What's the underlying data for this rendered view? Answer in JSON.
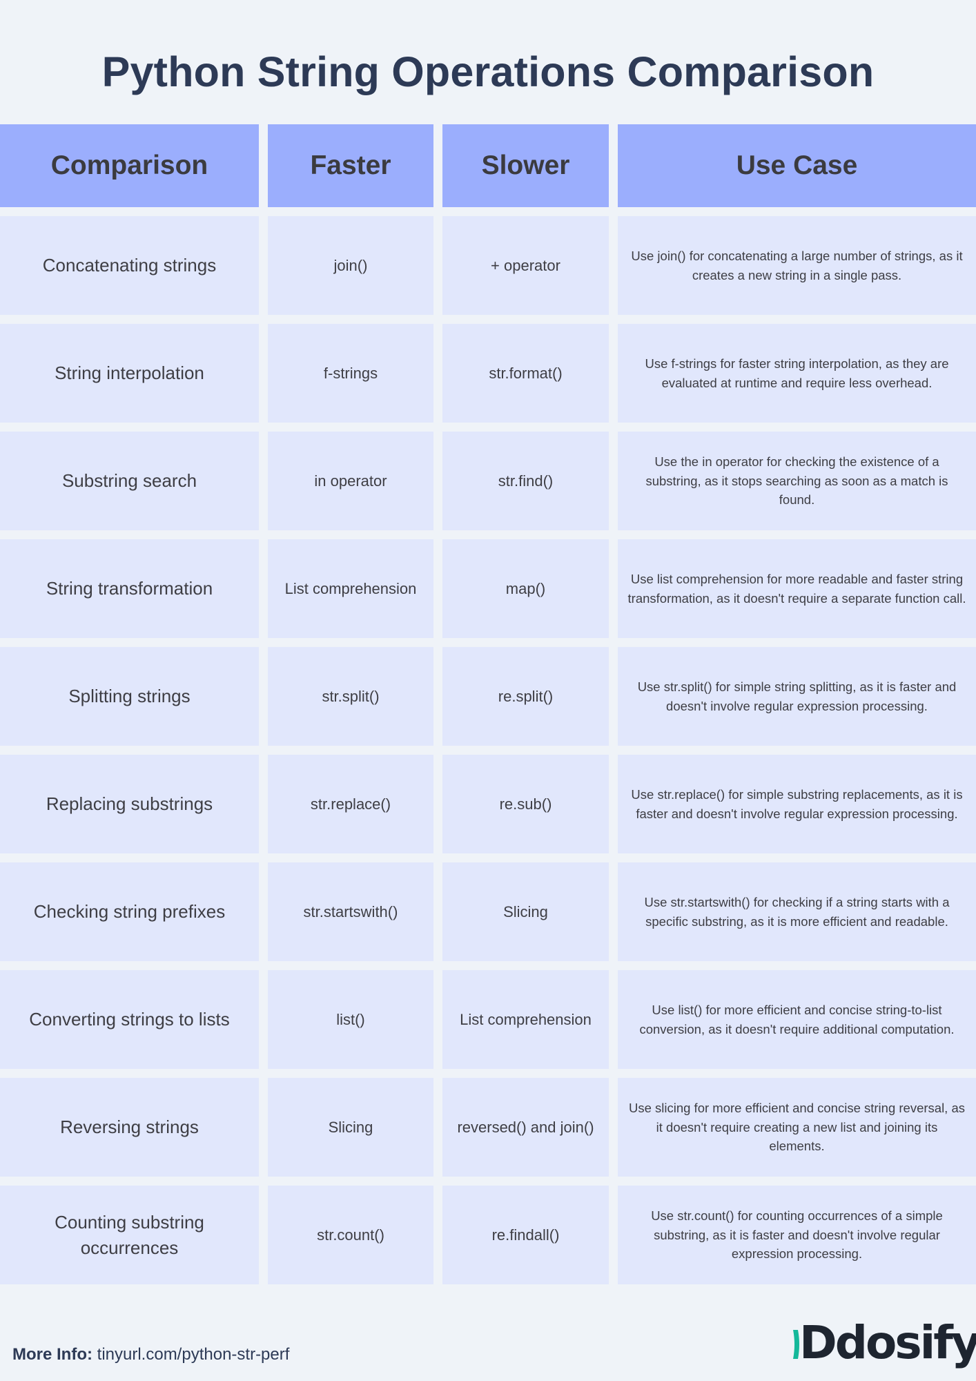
{
  "title": "Python String Operations Comparison",
  "table": {
    "headers": [
      "Comparison",
      "Faster",
      "Slower",
      "Use Case"
    ],
    "rows": [
      {
        "comparison": "Concatenating strings",
        "faster": "join()",
        "slower": "+ operator",
        "use_case": "Use join() for concatenating a large number of strings, as it creates a new string in a single pass."
      },
      {
        "comparison": "String interpolation",
        "faster": "f-strings",
        "slower": "str.format()",
        "use_case": "Use f-strings for faster string interpolation, as they are evaluated at runtime and require less overhead."
      },
      {
        "comparison": "Substring search",
        "faster": "in operator",
        "slower": "str.find()",
        "use_case": "Use the in operator for checking the existence of a substring, as it stops searching as soon as a match is found."
      },
      {
        "comparison": "String transformation",
        "faster": "List comprehension",
        "slower": "map()",
        "use_case": "Use list comprehension for more readable and faster string transformation, as it doesn't require a separate function call."
      },
      {
        "comparison": "Splitting strings",
        "faster": "str.split()",
        "slower": "re.split()",
        "use_case": "Use str.split() for simple string splitting, as it is faster and doesn't involve regular expression processing."
      },
      {
        "comparison": "Replacing substrings",
        "faster": "str.replace()",
        "slower": "re.sub()",
        "use_case": "Use str.replace() for simple substring replacements, as it is faster and doesn't involve regular expression processing."
      },
      {
        "comparison": "Checking string prefixes",
        "faster": "str.startswith()",
        "slower": "Slicing",
        "use_case": "Use str.startswith() for checking if a string starts with a specific substring, as it is more efficient and readable."
      },
      {
        "comparison": "Converting strings to lists",
        "faster": "list()",
        "slower": "List comprehension",
        "use_case": "Use list() for more efficient and concise string-to-list conversion, as it doesn't require additional computation."
      },
      {
        "comparison": "Reversing strings",
        "faster": "Slicing",
        "slower": "reversed() and join()",
        "use_case": "Use slicing for more efficient and concise string reversal, as it doesn't require creating a new list and joining its elements."
      },
      {
        "comparison": "Counting substring occurrences",
        "faster": "str.count()",
        "slower": "re.findall()",
        "use_case": "Use str.count() for counting occurrences of a simple substring, as it is faster and doesn't involve regular expression processing."
      }
    ]
  },
  "footer": {
    "more_info_label": "More Info:",
    "more_info_link": "tinyurl.com/python-str-perf",
    "logo_text": "Ddosify",
    "logo_icon": "ddosify-logo-icon"
  },
  "colors": {
    "background": "#EFF3F8",
    "header_fill": "#9BAEFD",
    "cell_fill": "#E1E7FC",
    "title_text": "#2D3A56",
    "logo_accent": "#14B89A",
    "logo_text": "#1E2530"
  }
}
